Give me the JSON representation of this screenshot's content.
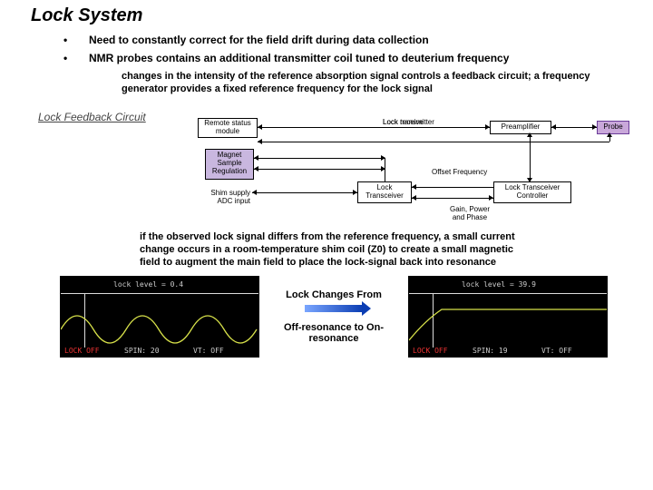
{
  "title": "Lock System",
  "bullets": [
    "Need to constantly correct for the field drift during data collection",
    "NMR probes contains an additional transmitter coil tuned to deuterium frequency"
  ],
  "sub1": "changes in the intensity of the reference absorption signal controls a feedback circuit; a frequency generator provides a fixed reference frequency for the lock signal",
  "diagram_label": "Lock Feedback Circuit",
  "nodes": {
    "remote": "Remote status\nmodule",
    "magnet": "Magnet\nSample\nRegulation",
    "shim": "Shim supply\nADC input",
    "transceiver": "Lock\nTransceiver",
    "controller": "Lock Transceiver\nController",
    "preamp": "Preamplifier",
    "probe": "Probe"
  },
  "labels": {
    "lock_receive": "Lock receive",
    "lock_transmitter": "Lock transmitter",
    "offset_freq": "Offset Frequency",
    "gain": "Gain, Power\nand Phase"
  },
  "sub2": "if the observed lock signal differs from the reference frequency, a small current change occurs in a room-temperature shim coil (Z0) to create a small magnetic field to augment  the main field to place the lock-signal  back into resonance",
  "change": {
    "t1": "Lock Changes From",
    "t2": "Off-resonance to On-resonance"
  },
  "scopeA": {
    "header": "lock level =   0.4",
    "footer_left": "LOCK OFF",
    "spin": "SPIN:   20",
    "vt": "VT: OFF"
  },
  "scopeB": {
    "header": "lock level =  39.9",
    "footer_left": "LOCK OFF",
    "spin": "SPIN:   19",
    "vt": "VT: OFF"
  }
}
